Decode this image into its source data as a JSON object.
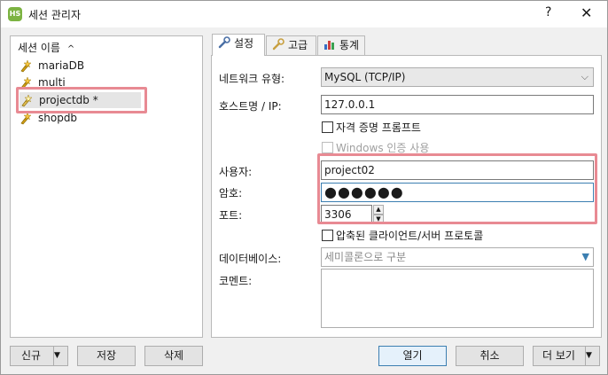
{
  "window": {
    "title": "세션 관리자",
    "app_icon_text": "HS",
    "help_glyph": "?",
    "close_glyph": "✕"
  },
  "sessions": {
    "header": "세션 이름",
    "sort_glyph": "^",
    "items": [
      {
        "label": "mariaDB",
        "selected": false
      },
      {
        "label": "multi",
        "selected": false
      },
      {
        "label": "projectdb *",
        "selected": true
      },
      {
        "label": "shopdb",
        "selected": false
      }
    ]
  },
  "bottom_left_buttons": {
    "new_label": "신규",
    "save_label": "저장",
    "delete_label": "삭제"
  },
  "bottom_right_buttons": {
    "open_label": "열기",
    "cancel_label": "취소",
    "more_label": "더 보기"
  },
  "tabs": [
    {
      "label": "설정",
      "icon": "wrench-icon",
      "active": true
    },
    {
      "label": "고급",
      "icon": "wrench-icon",
      "active": false
    },
    {
      "label": "통계",
      "icon": "bar-chart-icon",
      "active": false
    }
  ],
  "settings": {
    "network_type_label": "네트워크 유형:",
    "network_type_value": "MySQL (TCP/IP)",
    "host_label": "호스트명 / IP:",
    "host_value": "127.0.0.1",
    "prompt_credentials_label": "자격 증명 프롬프트",
    "windows_auth_label": "Windows 인증 사용",
    "user_label": "사용자:",
    "user_value": "project02",
    "password_label": "암호:",
    "password_value": "●●●●●●",
    "port_label": "포트:",
    "port_value": "3306",
    "compressed_label": "압축된 클라이언트/서버 프로토콜",
    "database_label": "데이터베이스:",
    "database_placeholder": "세미콜론으로 구분",
    "comment_label": "코멘트:"
  },
  "colors": {
    "highlight": "#e88a93",
    "selection": "#e5e5e5"
  }
}
